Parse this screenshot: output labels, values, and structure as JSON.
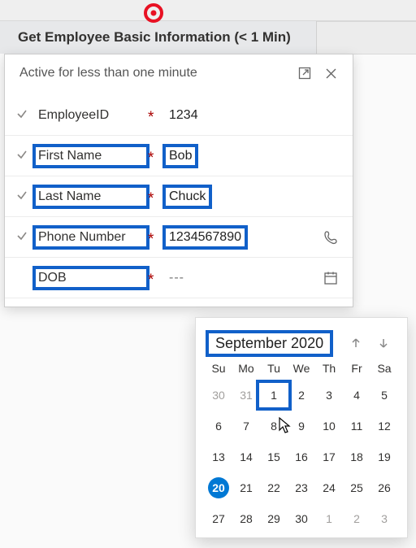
{
  "step": {
    "title": "Get Employee Basic Information  (< 1 Min)"
  },
  "panel": {
    "subtitle": "Active for less than one minute",
    "fields": [
      {
        "label": "EmployeeID",
        "value": "1234",
        "required": true,
        "hl_label": false,
        "hl_value": false,
        "check": true
      },
      {
        "label": "First Name",
        "value": "Bob",
        "required": true,
        "hl_label": true,
        "hl_value": true,
        "check": true
      },
      {
        "label": "Last Name",
        "value": "Chuck",
        "required": true,
        "hl_label": true,
        "hl_value": true,
        "check": true
      },
      {
        "label": "Phone Number",
        "value": "1234567890",
        "required": true,
        "hl_label": true,
        "hl_value": true,
        "check": true,
        "trailing_icon": "phone"
      },
      {
        "label": "DOB",
        "value": "---",
        "required": true,
        "hl_label": true,
        "hl_value": false,
        "check": false,
        "placeholder": true,
        "trailing_icon": "calendar"
      }
    ]
  },
  "datepicker": {
    "month_label": "September 2020",
    "dow": [
      "Su",
      "Mo",
      "Tu",
      "We",
      "Th",
      "Fr",
      "Sa"
    ],
    "days": [
      {
        "n": "30",
        "m": true
      },
      {
        "n": "31",
        "m": true
      },
      {
        "n": "1",
        "sel": true
      },
      {
        "n": "2"
      },
      {
        "n": "3"
      },
      {
        "n": "4"
      },
      {
        "n": "5"
      },
      {
        "n": "6"
      },
      {
        "n": "7"
      },
      {
        "n": "8"
      },
      {
        "n": "9"
      },
      {
        "n": "10"
      },
      {
        "n": "11"
      },
      {
        "n": "12"
      },
      {
        "n": "13"
      },
      {
        "n": "14"
      },
      {
        "n": "15"
      },
      {
        "n": "16"
      },
      {
        "n": "17"
      },
      {
        "n": "18"
      },
      {
        "n": "19"
      },
      {
        "n": "20",
        "today": true
      },
      {
        "n": "21"
      },
      {
        "n": "22"
      },
      {
        "n": "23"
      },
      {
        "n": "24"
      },
      {
        "n": "25"
      },
      {
        "n": "26"
      },
      {
        "n": "27"
      },
      {
        "n": "28"
      },
      {
        "n": "29"
      },
      {
        "n": "30"
      },
      {
        "n": "1",
        "m": true
      },
      {
        "n": "2",
        "m": true
      },
      {
        "n": "3",
        "m": true
      }
    ]
  }
}
